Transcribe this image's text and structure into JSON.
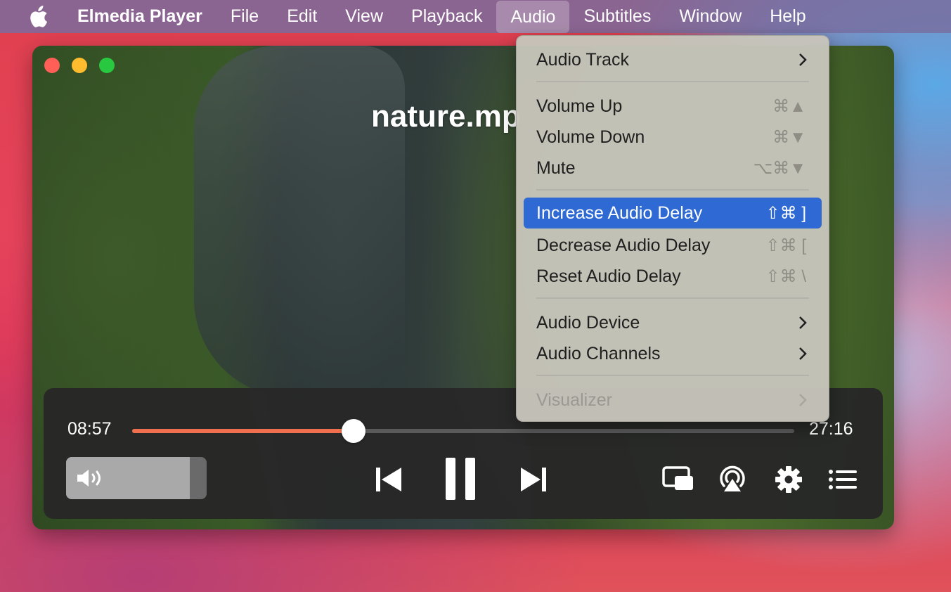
{
  "menubar": {
    "app_name": "Elmedia Player",
    "items": [
      "File",
      "Edit",
      "View",
      "Playback",
      "Audio",
      "Subtitles",
      "Window",
      "Help"
    ],
    "active": "Audio"
  },
  "player": {
    "title": "nature.mp",
    "current_time": "08:57",
    "total_time": "27:16",
    "progress_fraction": 0.334,
    "volume_fraction": 0.88,
    "accent_color": "#ef6f4f"
  },
  "audio_menu": {
    "audio_track": "Audio Track",
    "volume_up": "Volume Up",
    "volume_up_shortcut": "⌘▲",
    "volume_down": "Volume Down",
    "volume_down_shortcut": "⌘▼",
    "mute": "Mute",
    "mute_shortcut": "⌥⌘▼",
    "increase_delay": "Increase Audio Delay",
    "increase_delay_shortcut": "⇧⌘ ]",
    "decrease_delay": "Decrease Audio Delay",
    "decrease_delay_shortcut": "⇧⌘ [",
    "reset_delay": "Reset Audio Delay",
    "reset_delay_shortcut": "⇧⌘ \\",
    "audio_device": "Audio Device",
    "audio_channels": "Audio Channels",
    "visualizer": "Visualizer",
    "highlight_color": "#2f6ad4"
  },
  "icons": [
    "apple-icon",
    "speaker-icon",
    "previous-track-icon",
    "pause-icon",
    "next-track-icon",
    "picture-in-picture-icon",
    "airplay-icon",
    "gear-icon",
    "playlist-icon",
    "chevron-right-icon"
  ]
}
